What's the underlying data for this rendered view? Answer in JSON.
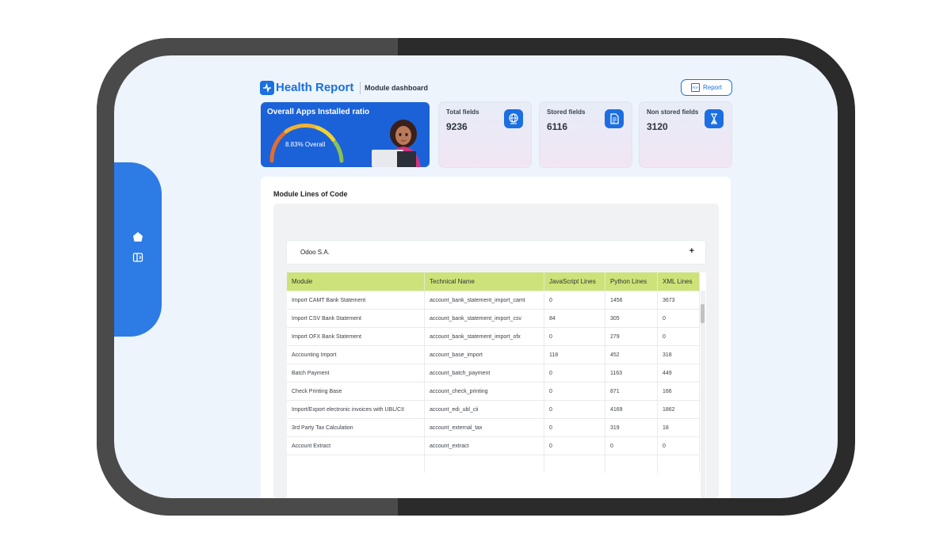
{
  "header": {
    "app_title": "Health Report",
    "subtitle": "Module dashboard",
    "report_button": "Report",
    "pdf_icon_label": "PDF"
  },
  "sidebar": {
    "items": [
      {
        "icon": "home-icon"
      },
      {
        "icon": "sidebar-toggle-icon"
      }
    ]
  },
  "ratio_card": {
    "title": "Overall Apps Installed ratio",
    "value_text": "8.83% Overall",
    "percent": 8.83,
    "gauge_colors": [
      "#f2b233",
      "#e26d2f",
      "#f2d233",
      "#8cc152"
    ]
  },
  "stats": [
    {
      "title": "Total fields",
      "value": "9236",
      "icon": "globe-icon"
    },
    {
      "title": "Stored fields",
      "value": "6116",
      "icon": "document-icon"
    },
    {
      "title": "Non stored fields",
      "value": "3120",
      "icon": "hourglass-icon"
    }
  ],
  "panel": {
    "title": "Module Lines of Code",
    "company": "Odoo S.A.",
    "expand_symbol": "+"
  },
  "table": {
    "columns": [
      "Module",
      "Technical Name",
      "JavaScript Lines",
      "Python Lines",
      "XML Lines"
    ],
    "rows": [
      [
        "Import CAMT Bank Statement",
        "account_bank_statement_import_camt",
        "0",
        "1456",
        "3673"
      ],
      [
        "Import CSV Bank Statement",
        "account_bank_statement_import_csv",
        "84",
        "305",
        "0"
      ],
      [
        "Import OFX Bank Statement",
        "account_bank_statement_import_ofx",
        "0",
        "279",
        "0"
      ],
      [
        "Accounting Import",
        "account_base_import",
        "118",
        "452",
        "318"
      ],
      [
        "Batch Payment",
        "account_batch_payment",
        "0",
        "1163",
        "449"
      ],
      [
        "Check Printing Base",
        "account_check_printing",
        "0",
        "871",
        "166"
      ],
      [
        "Import/Export electronic invoices with UBL/CII",
        "account_edi_ubl_cii",
        "0",
        "4169",
        "1862"
      ],
      [
        "3rd Party Tax Calculation",
        "account_external_tax",
        "0",
        "319",
        "18"
      ],
      [
        "Account Extract",
        "account_extract",
        "0",
        "0",
        "0"
      ],
      [
        "",
        "",
        "",
        "",
        ""
      ]
    ]
  },
  "colors": {
    "accent": "#1b6fe0",
    "table_header": "#cde37a",
    "screen_bg": "#edf4fc"
  }
}
